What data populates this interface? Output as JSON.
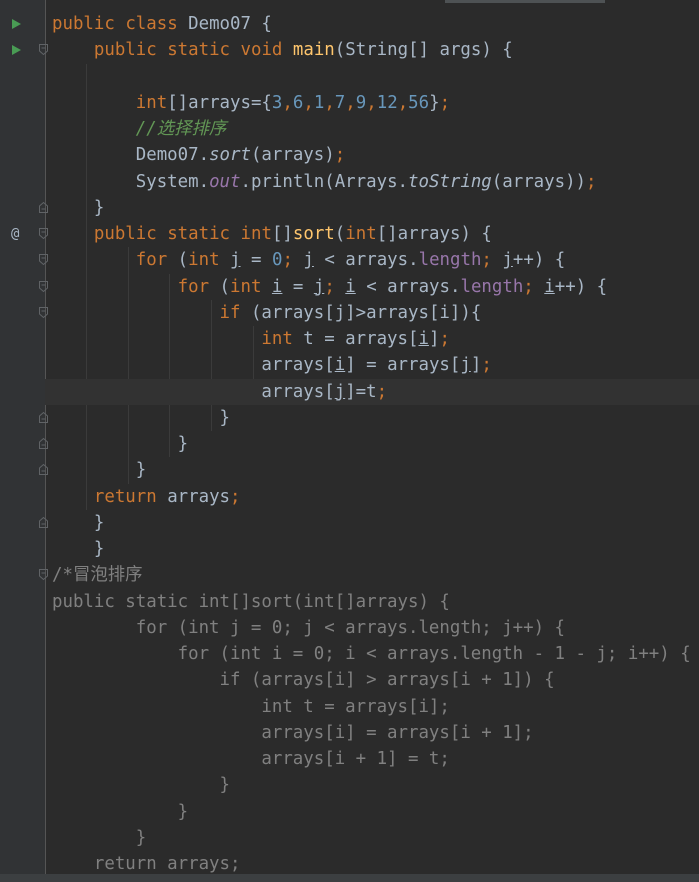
{
  "editor": {
    "language": "java",
    "lines": [
      "public class Demo07 {",
      "    public static void main(String[] args) {",
      "",
      "        int[]arrays={3,6,1,7,9,12,56};",
      "        //选择排序",
      "        Demo07.sort(arrays);",
      "        System.out.println(Arrays.toString(arrays));",
      "    }",
      "    public static int[]sort(int[]arrays) {",
      "        for (int j = 0; j < arrays.length; j++) {",
      "            for (int i = j; i < arrays.length; i++) {",
      "                if (arrays[j]>arrays[i]){",
      "                    int t = arrays[i];",
      "                    arrays[i] = arrays[j];",
      "                    arrays[j]=t;",
      "                }",
      "            }",
      "        }",
      "    return arrays;",
      "    }",
      "    }",
      "/*冒泡排序",
      "public static int[]sort(int[]arrays) {",
      "        for (int j = 0; j < arrays.length; j++) {",
      "            for (int i = 0; i < arrays.length - 1 - j; i++) {",
      "                if (arrays[i] > arrays[i + 1]) {",
      "                    int t = arrays[i];",
      "                    arrays[i] = arrays[i + 1];",
      "                    arrays[i + 1] = t;",
      "                }",
      "            }",
      "        }",
      "    return arrays;"
    ]
  },
  "gutter": {
    "run_icon": "run-play-icon",
    "override_icon": "at-override-icon",
    "override_glyph": "@",
    "fold_icon": "fold-marker-icon"
  },
  "colors": {
    "background": "#2b2b2b",
    "gutter": "#313335",
    "keyword": "#cc7832",
    "number": "#6897bb",
    "method": "#ffc66d",
    "field": "#9876aa",
    "comment": "#629755",
    "block_comment": "#808080",
    "text": "#a9b7c6",
    "run_icon": "#499c54"
  }
}
